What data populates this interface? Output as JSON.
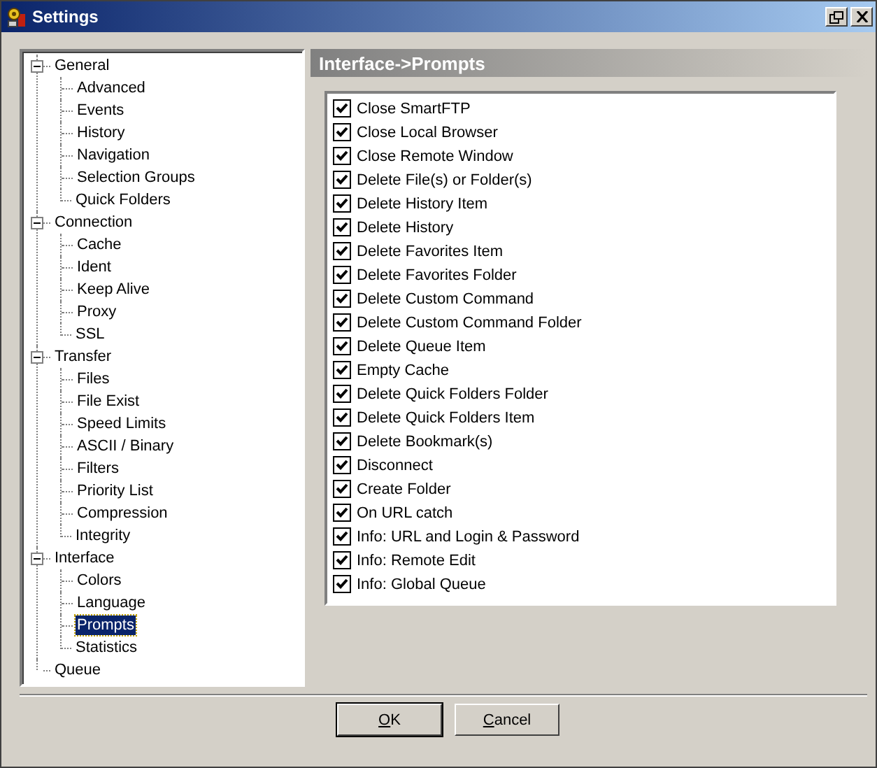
{
  "window": {
    "title": "Settings"
  },
  "tree": [
    {
      "label": "General",
      "expanded": true,
      "selected": false,
      "children": [
        {
          "label": "Advanced",
          "selected": false
        },
        {
          "label": "Events",
          "selected": false
        },
        {
          "label": "History",
          "selected": false
        },
        {
          "label": "Navigation",
          "selected": false
        },
        {
          "label": "Selection Groups",
          "selected": false
        },
        {
          "label": "Quick Folders",
          "selected": false
        }
      ]
    },
    {
      "label": "Connection",
      "expanded": true,
      "selected": false,
      "children": [
        {
          "label": "Cache",
          "selected": false
        },
        {
          "label": "Ident",
          "selected": false
        },
        {
          "label": "Keep Alive",
          "selected": false
        },
        {
          "label": "Proxy",
          "selected": false
        },
        {
          "label": "SSL",
          "selected": false
        }
      ]
    },
    {
      "label": "Transfer",
      "expanded": true,
      "selected": false,
      "children": [
        {
          "label": "Files",
          "selected": false
        },
        {
          "label": "File Exist",
          "selected": false
        },
        {
          "label": "Speed Limits",
          "selected": false
        },
        {
          "label": "ASCII / Binary",
          "selected": false
        },
        {
          "label": "Filters",
          "selected": false
        },
        {
          "label": "Priority List",
          "selected": false
        },
        {
          "label": "Compression",
          "selected": false
        },
        {
          "label": "Integrity",
          "selected": false
        }
      ]
    },
    {
      "label": "Interface",
      "expanded": true,
      "selected": false,
      "children": [
        {
          "label": "Colors",
          "selected": false
        },
        {
          "label": "Language",
          "selected": false
        },
        {
          "label": "Prompts",
          "selected": true
        },
        {
          "label": "Statistics",
          "selected": false
        }
      ]
    },
    {
      "label": "Queue",
      "selected": false
    }
  ],
  "panel": {
    "title": "Interface->Prompts"
  },
  "prompts": [
    {
      "label": "Close SmartFTP",
      "checked": true
    },
    {
      "label": "Close Local Browser",
      "checked": true
    },
    {
      "label": "Close Remote Window",
      "checked": true
    },
    {
      "label": "Delete File(s) or Folder(s)",
      "checked": true
    },
    {
      "label": "Delete History Item",
      "checked": true
    },
    {
      "label": "Delete History",
      "checked": true
    },
    {
      "label": "Delete Favorites Item",
      "checked": true
    },
    {
      "label": "Delete Favorites Folder",
      "checked": true
    },
    {
      "label": "Delete Custom Command",
      "checked": true
    },
    {
      "label": "Delete Custom Command Folder",
      "checked": true
    },
    {
      "label": "Delete Queue Item",
      "checked": true
    },
    {
      "label": "Empty Cache",
      "checked": true
    },
    {
      "label": "Delete Quick Folders Folder",
      "checked": true
    },
    {
      "label": "Delete Quick Folders Item",
      "checked": true
    },
    {
      "label": "Delete Bookmark(s)",
      "checked": true
    },
    {
      "label": "Disconnect",
      "checked": true
    },
    {
      "label": "Create Folder",
      "checked": true
    },
    {
      "label": "On URL catch",
      "checked": true
    },
    {
      "label": "Info: URL and Login & Password",
      "checked": true
    },
    {
      "label": "Info: Remote Edit",
      "checked": true
    },
    {
      "label": "Info: Global Queue",
      "checked": true
    }
  ],
  "buttons": [
    {
      "label": "OK",
      "default": true
    },
    {
      "label": "Cancel",
      "default": false
    }
  ]
}
